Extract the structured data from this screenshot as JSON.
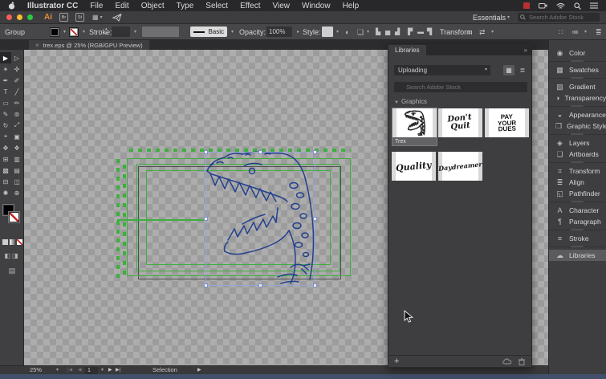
{
  "menu_bar": {
    "items": [
      "Illustrator CC",
      "File",
      "Edit",
      "Object",
      "Type",
      "Select",
      "Effect",
      "View",
      "Window",
      "Help"
    ]
  },
  "title_bar": {
    "app_badge": "Ai",
    "bridge_badge": "Br",
    "stock_badge": "St",
    "workspace_label": "Essentials",
    "search_placeholder": "Search Adobe Stock"
  },
  "control_bar": {
    "selection_type": "Group",
    "stroke_label": "Stroke:",
    "stroke_weight": "",
    "brush_definition": "Basic",
    "opacity_label": "Opacity:",
    "opacity_value": "100%",
    "style_label": "Style:",
    "transform_label": "Transform",
    "align_glyphs": [
      "▙",
      "▅",
      "▟",
      "▛",
      "▬",
      "▜"
    ]
  },
  "document_tab": {
    "close": "×",
    "title": "trex.eps @ 25% (RGB/GPU Preview)"
  },
  "tools": {
    "glyphs": [
      "▶",
      "▷",
      "✴",
      "✣",
      "✒",
      "✐",
      "T",
      "╱",
      "▭",
      "✏",
      "✎",
      "⊚",
      "↻",
      "⤢",
      "⌖",
      "▣",
      "✥",
      "❖",
      "⊞",
      "▥",
      "▩",
      "▤",
      "⊟",
      "◫",
      "✺",
      "⊕"
    ]
  },
  "libraries_panel": {
    "tab_title": "Libraries",
    "collapse_icon": "»",
    "library_select_value": "Uploading",
    "search_placeholder": "Search Adobe Stock",
    "section_label": "Graphics",
    "items": [
      {
        "label": "Trex"
      },
      {
        "lines": [
          "Don't",
          "Quit"
        ]
      },
      {
        "lines": [
          "PAY",
          "YOUR",
          "DUES"
        ]
      },
      {
        "lines": [
          "Quality"
        ]
      },
      {
        "lines": [
          "Daydreamer"
        ]
      }
    ],
    "add_button": "+"
  },
  "dock": {
    "selected": "Libraries",
    "groups": [
      {
        "items": [
          {
            "label": "Color",
            "icon": "◉"
          }
        ]
      },
      {
        "items": [
          {
            "label": "Swatches",
            "icon": "▦"
          }
        ]
      },
      {
        "items": [
          {
            "label": "Gradient",
            "icon": "▧"
          },
          {
            "label": "Transparency",
            "icon": "◑"
          }
        ]
      },
      {
        "items": [
          {
            "label": "Appearance",
            "icon": "◒"
          },
          {
            "label": "Graphic Styles",
            "icon": "❐"
          }
        ]
      },
      {
        "items": [
          {
            "label": "Layers",
            "icon": "◈"
          },
          {
            "label": "Artboards",
            "icon": "❏"
          }
        ]
      },
      {
        "items": [
          {
            "label": "Transform",
            "icon": "⌗"
          },
          {
            "label": "Align",
            "icon": "≣"
          },
          {
            "label": "Pathfinder",
            "icon": "◱"
          }
        ]
      },
      {
        "items": [
          {
            "label": "Character",
            "icon": "A"
          },
          {
            "label": "Paragraph",
            "icon": "¶"
          }
        ]
      },
      {
        "items": [
          {
            "label": "Stroke",
            "icon": "≡"
          }
        ]
      },
      {
        "items": [
          {
            "label": "Libraries",
            "icon": "☁"
          }
        ]
      }
    ]
  },
  "status_bar": {
    "zoom_value": "25%",
    "nav_first": "|◀",
    "nav_prev": "◀",
    "artboard_current": "1",
    "nav_next": "▶",
    "nav_last": "▶|",
    "status_field": "Selection",
    "status_arrow": "▶"
  },
  "icons": {
    "chevron_down": "▾",
    "chevron_right": "▸",
    "stepper_up": "▴",
    "stepper_down": "▾",
    "layout_icon": "▦",
    "globe": "◐",
    "document": "❏",
    "transform_panel": "⌗",
    "shuffle": "⇄",
    "workspace_grid": "∷",
    "panel_options": "≔",
    "panel_list": "≣",
    "grid_view": "▦",
    "list_view": "≣",
    "section_triangle": "▼",
    "draw_modes": "◧◨",
    "screen_mode": "▤"
  },
  "colors": {
    "artwork_stroke_blue": "#24418e",
    "guide_green": "#38b038",
    "selection_outline": "#96a5d8",
    "traffic_red": "#f85f57",
    "traffic_yellow": "#fdbc2e",
    "traffic_green": "#2ac840",
    "ai_logo_orange": "#e08b3a",
    "stroke_none_red": "#cc2222",
    "panel_bg": "#3e3e40",
    "canvas_checker_light": "#adadad",
    "canvas_checker_dark": "#9c9c9c"
  }
}
